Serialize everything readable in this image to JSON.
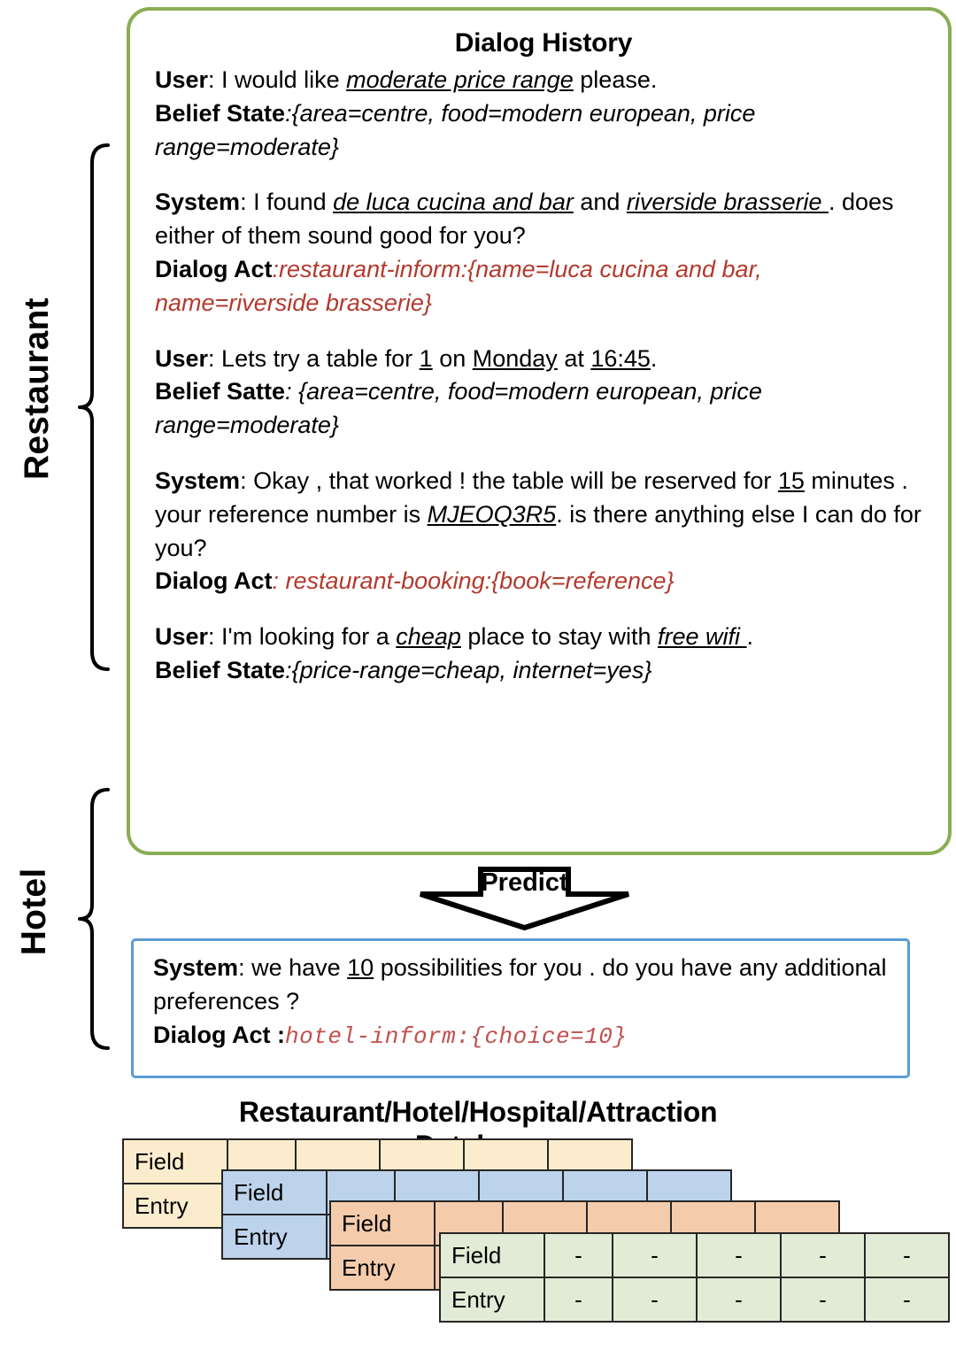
{
  "side_labels": {
    "restaurant": "Restaurant",
    "hotel": "Hotel"
  },
  "dialog": {
    "title": "Dialog History",
    "turns": [
      {
        "speaker": "User",
        "utterance_pre": ": I would like ",
        "slot": "moderate price range",
        "utterance_post": " please.",
        "state_label": "Belief State",
        "state_value": ":{area=centre, food=modern european, price range=moderate}"
      },
      {
        "speaker": "System",
        "utterance_pre": ": I found ",
        "slot": "de luca cucina and bar",
        "utterance_mid": " and ",
        "slot2": "riverside brasserie ",
        "utterance_post": ". does either of them sound good for you?",
        "act_label": "Dialog Act",
        "act_value": ":restaurant-inform:{name=luca cucina and bar, name=riverside brasserie}"
      },
      {
        "speaker": "User",
        "utterance_pre": ": Lets try a table for ",
        "slot": "1",
        "utterance_mid": " on ",
        "slot2": "Monday",
        "utterance_mid2": " at ",
        "slot3": "16:45",
        "utterance_post": ".",
        "state_label": "Belief Satte",
        "state_value": ": {area=centre, food=modern european, price range=moderate}"
      },
      {
        "speaker": "System",
        "utterance_pre": ": Okay , that worked ! the table will be reserved for ",
        "slot": "15",
        "utterance_mid": " minutes . your reference number is ",
        "slot2": "MJEOQ3R5",
        "utterance_post": ". is there anything else I can do for you?",
        "act_label": "Dialog Act",
        "act_value": ": restaurant-booking:{book=reference}"
      },
      {
        "speaker": "User",
        "utterance_pre": ":  I'm looking  for a ",
        "slot": "cheap",
        "utterance_mid": " place to stay with ",
        "slot2": "free wifi ",
        "utterance_post": ".",
        "state_label": "Belief State",
        "state_value": ":{price-range=cheap, internet=yes}"
      }
    ]
  },
  "predict": {
    "arrow_label": "Predict"
  },
  "prediction": {
    "speaker": "System",
    "utterance_pre": ": we have ",
    "slot": "10",
    "utterance_post": " possibilities  for you . do you have any additional preferences ?",
    "act_label": "Dialog Act :",
    "act_value": "hotel-inform:{choice=10}"
  },
  "database": {
    "title": "Restaurant/Hotel/Hospital/Attraction",
    "subtitle": "Database",
    "row_labels": {
      "field": "Field",
      "entry": "Entry"
    },
    "empty_cell": "-",
    "colors": {
      "tan": "#fbeccd",
      "blue": "#bdd3ec",
      "orange": "#f5ccab",
      "green": "#e2ebd6",
      "border": "#262626"
    },
    "tables": [
      {
        "name": "restaurant-db",
        "color": "#fbeccd",
        "cells": [
          "",
          "",
          "",
          "",
          ""
        ]
      },
      {
        "name": "hotel-db",
        "color": "#bdd3ec",
        "cells": [
          "",
          "",
          "",
          "",
          ""
        ]
      },
      {
        "name": "hospital-db",
        "color": "#f5ccab",
        "cells": [
          "",
          "",
          "",
          "",
          ""
        ]
      },
      {
        "name": "attraction-db",
        "color": "#e2ebd6",
        "cells": [
          "-",
          "-",
          "-",
          "-",
          "-"
        ]
      }
    ]
  }
}
